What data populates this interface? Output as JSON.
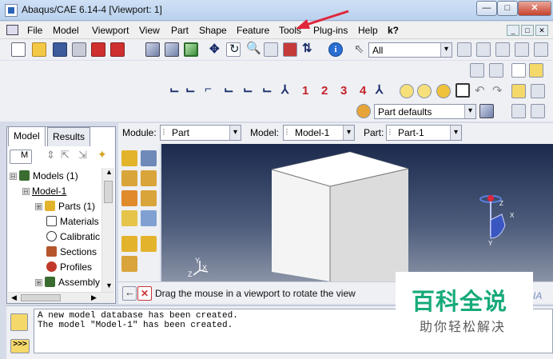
{
  "window": {
    "title": "Abaqus/CAE 6.14-4 [Viewport: 1]",
    "controls": {
      "minimize": "—",
      "maximize": "□",
      "close": "✕"
    }
  },
  "menubar": {
    "items": [
      "File",
      "Model",
      "Viewport",
      "View",
      "Part",
      "Shape",
      "Feature",
      "Tools",
      "Plug-ins",
      "Help"
    ],
    "help_query": "k?",
    "mdi": [
      "_",
      "□",
      "✕"
    ]
  },
  "toolbar": {
    "selection_filter": "All",
    "view_numbers": [
      "1",
      "2",
      "3",
      "4"
    ],
    "render_style": "Part defaults"
  },
  "context": {
    "module_label": "Module:",
    "module_value": "Part",
    "model_label": "Model:",
    "model_value": "Model-1",
    "part_label": "Part:",
    "part_value": "Part-1"
  },
  "model_tree": {
    "tabs": [
      "Model",
      "Results"
    ],
    "tree_filter": "M",
    "nodes": [
      {
        "label": "Models (1)",
        "expander": "⊟"
      },
      {
        "label": "Model-1",
        "expander": "⊟"
      },
      {
        "label": "Parts (1)",
        "expander": "⊞"
      },
      {
        "label": "Materials",
        "expander": ""
      },
      {
        "label": "Calibratic",
        "expander": ""
      },
      {
        "label": "Sections",
        "expander": ""
      },
      {
        "label": "Profiles",
        "expander": ""
      },
      {
        "label": "Assembly",
        "expander": "⊞"
      }
    ]
  },
  "viewport": {
    "triad_labels": {
      "x": "X",
      "y": "Y",
      "z": "Z"
    },
    "prompt": "Drag the mouse in a viewport to rotate the view"
  },
  "messages": [
    "A new model database has been created.",
    "The model \"Model-1\" has been created."
  ],
  "watermark": {
    "title": "百科全说",
    "subtitle": "助你轻松解决",
    "edge_text": "IA"
  },
  "colors": {
    "accent_red": "#c4232b",
    "watermark_green": "#16aa7a",
    "viewport_top": "#1b2a4d",
    "arrow": "#e0263a"
  }
}
